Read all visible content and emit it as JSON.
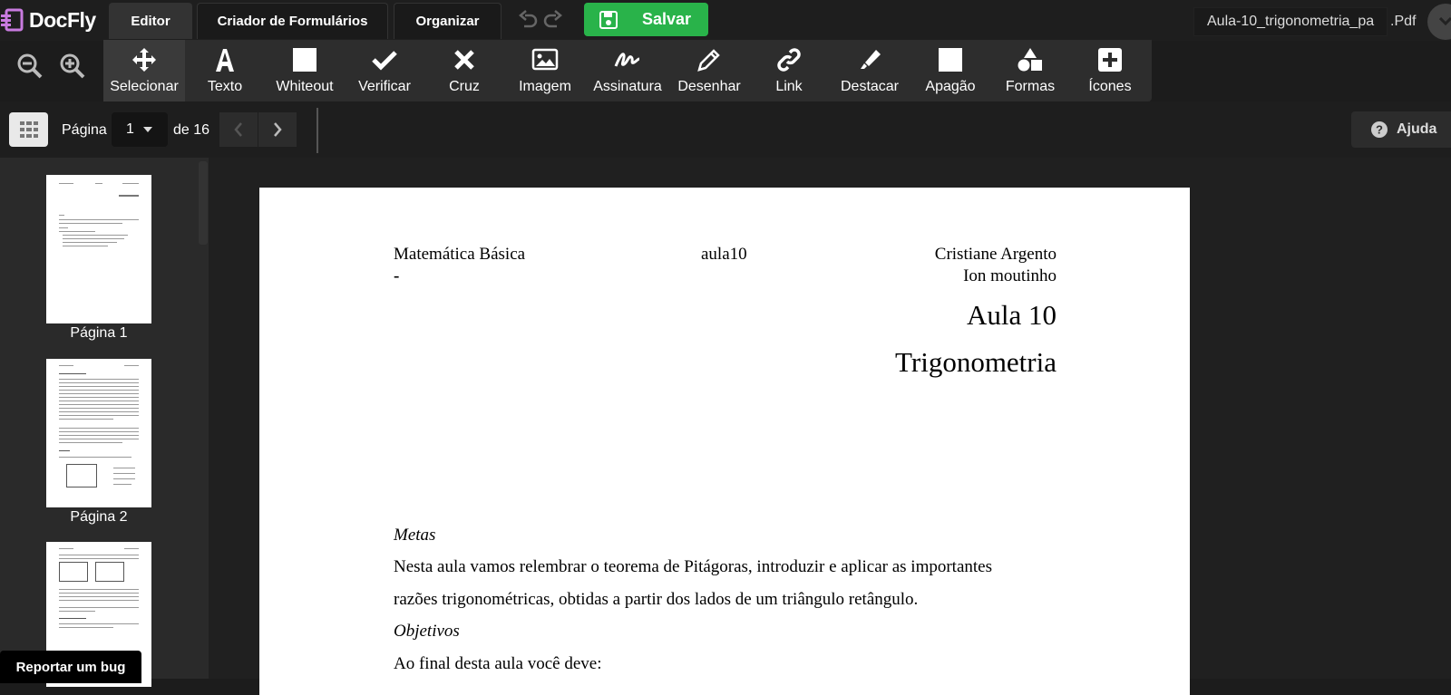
{
  "app": {
    "brand": "DocFly",
    "accent": "#29b34a"
  },
  "tabs": [
    {
      "label": "Editor",
      "active": true
    },
    {
      "label": "Criador de Formulários"
    },
    {
      "label": "Organizar"
    }
  ],
  "save_label": "Salvar",
  "file": {
    "name": "Aula-10_trigonometria_pa",
    "ext": ".Pdf"
  },
  "tools": [
    {
      "label": "Selecionar",
      "icon": "move-icon",
      "selected": true
    },
    {
      "label": "Texto",
      "icon": "text-icon"
    },
    {
      "label": "Whiteout",
      "icon": "whiteout-icon"
    },
    {
      "label": "Verificar",
      "icon": "check-icon"
    },
    {
      "label": "Cruz",
      "icon": "cross-icon"
    },
    {
      "label": "Imagem",
      "icon": "image-icon"
    },
    {
      "label": "Assinatura",
      "icon": "signature-icon"
    },
    {
      "label": "Desenhar",
      "icon": "pencil-icon"
    },
    {
      "label": "Link",
      "icon": "link-icon"
    },
    {
      "label": "Destacar",
      "icon": "highlighter-icon"
    },
    {
      "label": "Apagão",
      "icon": "blackout-icon"
    },
    {
      "label": "Formas",
      "icon": "shapes-icon"
    },
    {
      "label": "Ícones",
      "icon": "plus-square-icon"
    }
  ],
  "pager": {
    "label": "Página",
    "current": "1",
    "of_label": "de 16"
  },
  "help_label": "Ajuda",
  "thumbnails": [
    {
      "label": "Página 1"
    },
    {
      "label": "Página 2"
    },
    {
      "label": ""
    }
  ],
  "bug_label": "Reportar um bug",
  "document": {
    "header_left": "Matemática Básica",
    "header_left_sub": "-",
    "header_center": "aula10",
    "header_right_1": "Cristiane Argento",
    "header_right_2": "Ion moutinho",
    "title_1": "Aula 10",
    "title_2": "Trigonometria",
    "metas_heading": "Metas",
    "metas_line_1": "Nesta aula vamos relembrar o teorema de Pitágoras, introduzir e aplicar as importantes",
    "metas_line_2": "razões trigonométricas, obtidas a partir dos lados de um triângulo retângulo.",
    "objetivos_heading": "Objetivos",
    "objetivos_line_1": "Ao final desta aula você deve:"
  }
}
